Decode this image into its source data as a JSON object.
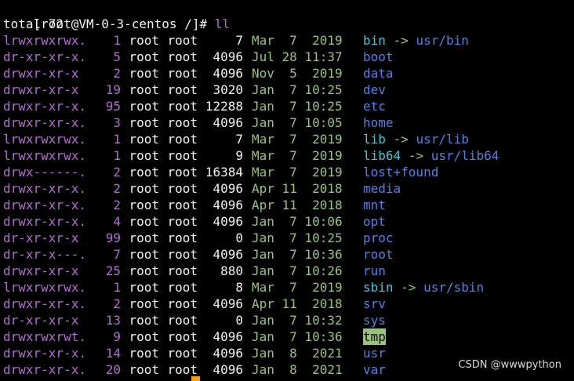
{
  "prompt": {
    "text": "[root@VM-0-3-centos /]# ",
    "command": "ll"
  },
  "total_line": "total 72",
  "rows": [
    {
      "perm": "lrwxrwxrwx.",
      "links": "1",
      "owner": "root",
      "group": "root",
      "size": "7",
      "date": "Mar  7  2019",
      "name": "bin",
      "type": "link",
      "target": "usr/bin"
    },
    {
      "perm": "dr-xr-xr-x.",
      "links": "5",
      "owner": "root",
      "group": "root",
      "size": "4096",
      "date": "Jul 28 11:37",
      "name": "boot",
      "type": "dir"
    },
    {
      "perm": "drwxr-xr-x",
      "links": "2",
      "owner": "root",
      "group": "root",
      "size": "4096",
      "date": "Nov  5  2019",
      "name": "data",
      "type": "dir"
    },
    {
      "perm": "drwxr-xr-x",
      "links": "19",
      "owner": "root",
      "group": "root",
      "size": "3020",
      "date": "Jan  7 10:25",
      "name": "dev",
      "type": "dir"
    },
    {
      "perm": "drwxr-xr-x.",
      "links": "95",
      "owner": "root",
      "group": "root",
      "size": "12288",
      "date": "Jan  7 10:25",
      "name": "etc",
      "type": "dir"
    },
    {
      "perm": "drwxr-xr-x.",
      "links": "3",
      "owner": "root",
      "group": "root",
      "size": "4096",
      "date": "Jan  7 10:05",
      "name": "home",
      "type": "dir"
    },
    {
      "perm": "lrwxrwxrwx.",
      "links": "1",
      "owner": "root",
      "group": "root",
      "size": "7",
      "date": "Mar  7  2019",
      "name": "lib",
      "type": "link",
      "target": "usr/lib"
    },
    {
      "perm": "lrwxrwxrwx.",
      "links": "1",
      "owner": "root",
      "group": "root",
      "size": "9",
      "date": "Mar  7  2019",
      "name": "lib64",
      "type": "link",
      "target": "usr/lib64"
    },
    {
      "perm": "drwx------.",
      "links": "2",
      "owner": "root",
      "group": "root",
      "size": "16384",
      "date": "Mar  7  2019",
      "name": "lost+found",
      "type": "dir"
    },
    {
      "perm": "drwxr-xr-x.",
      "links": "2",
      "owner": "root",
      "group": "root",
      "size": "4096",
      "date": "Apr 11  2018",
      "name": "media",
      "type": "dir"
    },
    {
      "perm": "drwxr-xr-x.",
      "links": "2",
      "owner": "root",
      "group": "root",
      "size": "4096",
      "date": "Apr 11  2018",
      "name": "mnt",
      "type": "dir"
    },
    {
      "perm": "drwxr-xr-x.",
      "links": "4",
      "owner": "root",
      "group": "root",
      "size": "4096",
      "date": "Jan  7 10:06",
      "name": "opt",
      "type": "dir"
    },
    {
      "perm": "dr-xr-xr-x",
      "links": "99",
      "owner": "root",
      "group": "root",
      "size": "0",
      "date": "Jan  7 10:25",
      "name": "proc",
      "type": "dir"
    },
    {
      "perm": "dr-xr-x---.",
      "links": "7",
      "owner": "root",
      "group": "root",
      "size": "4096",
      "date": "Jan  7 10:36",
      "name": "root",
      "type": "dir"
    },
    {
      "perm": "drwxr-xr-x",
      "links": "25",
      "owner": "root",
      "group": "root",
      "size": "880",
      "date": "Jan  7 10:26",
      "name": "run",
      "type": "dir"
    },
    {
      "perm": "lrwxrwxrwx.",
      "links": "1",
      "owner": "root",
      "group": "root",
      "size": "8",
      "date": "Mar  7  2019",
      "name": "sbin",
      "type": "link",
      "target": "usr/sbin"
    },
    {
      "perm": "drwxr-xr-x.",
      "links": "2",
      "owner": "root",
      "group": "root",
      "size": "4096",
      "date": "Apr 11  2018",
      "name": "srv",
      "type": "dir"
    },
    {
      "perm": "dr-xr-xr-x",
      "links": "13",
      "owner": "root",
      "group": "root",
      "size": "0",
      "date": "Jan  7 10:32",
      "name": "sys",
      "type": "dir"
    },
    {
      "perm": "drwxrwxrwt.",
      "links": "9",
      "owner": "root",
      "group": "root",
      "size": "4096",
      "date": "Jan  7 10:36",
      "name": "tmp",
      "type": "sticky"
    },
    {
      "perm": "drwxr-xr-x.",
      "links": "14",
      "owner": "root",
      "group": "root",
      "size": "4096",
      "date": "Jan  8  2021",
      "name": "usr",
      "type": "dir"
    },
    {
      "perm": "drwxr-xr-x.",
      "links": "20",
      "owner": "root",
      "group": "root",
      "size": "4096",
      "date": "Jan  8  2021",
      "name": "var",
      "type": "dir"
    }
  ],
  "link_arrow": "->",
  "watermark": "CSDN @wwwpython",
  "colors": {
    "background": "#000000",
    "foreground": "#f2f2f2",
    "permissions": "#b36bd1",
    "date": "#98c379",
    "directory": "#4f82e8",
    "symlink": "#3fc9d9",
    "sticky_bg": "#98c379",
    "cursor": "#f0a30a"
  }
}
